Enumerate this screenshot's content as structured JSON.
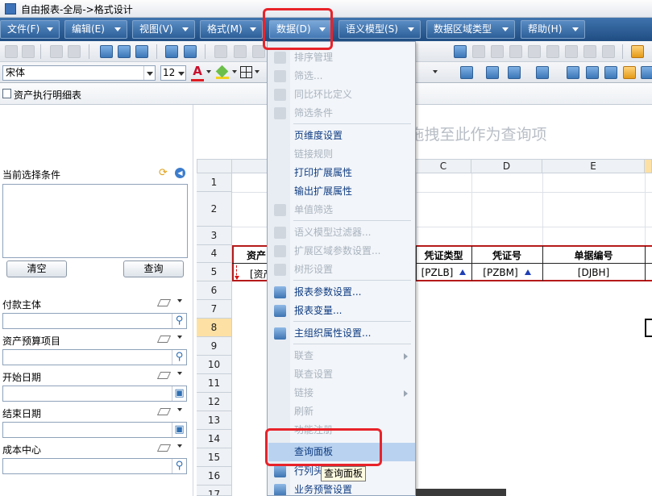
{
  "window": {
    "title": "自由报表-全局->格式设计"
  },
  "menubar": [
    {
      "label": "文件(F)"
    },
    {
      "label": "编辑(E)"
    },
    {
      "label": "视图(V)"
    },
    {
      "label": "格式(M)"
    },
    {
      "label": "数据(D)"
    },
    {
      "label": "语义模型(S)"
    },
    {
      "label": "数据区域类型"
    },
    {
      "label": "帮助(H)"
    }
  ],
  "format_toolbar": {
    "font_name": "宋体",
    "font_size": "12",
    "font_color_glyph": "A"
  },
  "document_tab": {
    "label": "资产执行明细表"
  },
  "left_panel": {
    "current_conditions_label": "当前选择条件",
    "clear_button": "清空",
    "query_button": "查询",
    "filters": [
      {
        "label": "付款主体",
        "button_icon": "search-icon"
      },
      {
        "label": "资产预算项目",
        "button_icon": "search-icon"
      },
      {
        "label": "开始日期",
        "button_icon": "calendar-icon"
      },
      {
        "label": "结束日期",
        "button_icon": "calendar-icon"
      },
      {
        "label": "成本中心",
        "button_icon": "search-icon"
      }
    ]
  },
  "sheet": {
    "drag_hint": "将语义模型字段拖拽至此作为查询项",
    "columns": [
      "C",
      "D",
      "E"
    ],
    "rows": [
      "1",
      "2",
      "3",
      "4",
      "5",
      "6",
      "7",
      "8",
      "9",
      "10",
      "11",
      "12",
      "13",
      "14",
      "15",
      "16",
      "17"
    ],
    "selected_row": "8",
    "row4": {
      "b": "资产",
      "c": "凭证类型",
      "d": "凭证号",
      "e": "单据编号"
    },
    "row5": {
      "b": "[资产",
      "c": "[PZLB]",
      "d": "[PZBM]",
      "e": "[DJBH]"
    }
  },
  "data_menu": {
    "items": [
      {
        "label": "排序管理",
        "enabled": false
      },
      {
        "label": "筛选...",
        "enabled": false
      },
      {
        "label": "同比环比定义",
        "enabled": false
      },
      {
        "label": "筛选条件",
        "enabled": false
      },
      {
        "label": "页维度设置",
        "enabled": true
      },
      {
        "label": "链接规则",
        "enabled": false
      },
      {
        "label": "打印扩展属性",
        "enabled": true
      },
      {
        "label": "输出扩展属性",
        "enabled": true
      },
      {
        "label": "单值筛选",
        "enabled": false
      },
      {
        "label": "语义模型过滤器...",
        "enabled": false
      },
      {
        "label": "扩展区域参数设置...",
        "enabled": false
      },
      {
        "label": "树形设置",
        "enabled": false
      },
      {
        "label": "报表参数设置...",
        "enabled": true
      },
      {
        "label": "报表变量...",
        "enabled": true
      },
      {
        "label": "主组织属性设置...",
        "enabled": true
      },
      {
        "label": "联查",
        "enabled": false
      },
      {
        "label": "联查设置",
        "enabled": false
      },
      {
        "label": "链接",
        "enabled": false
      },
      {
        "label": "刷新",
        "enabled": false
      },
      {
        "label": "功能注册",
        "enabled": false
      },
      {
        "label": "查询面板",
        "enabled": true
      },
      {
        "label": "行列头...",
        "enabled": true
      },
      {
        "label": "业务预警设置",
        "enabled": true
      }
    ],
    "tooltip": "查询面板"
  },
  "colors": {
    "menubar": "#2d5f98",
    "highlight": "#b9d2ef",
    "annotation": "#e8232a",
    "selected_row": "#fde1a4"
  }
}
